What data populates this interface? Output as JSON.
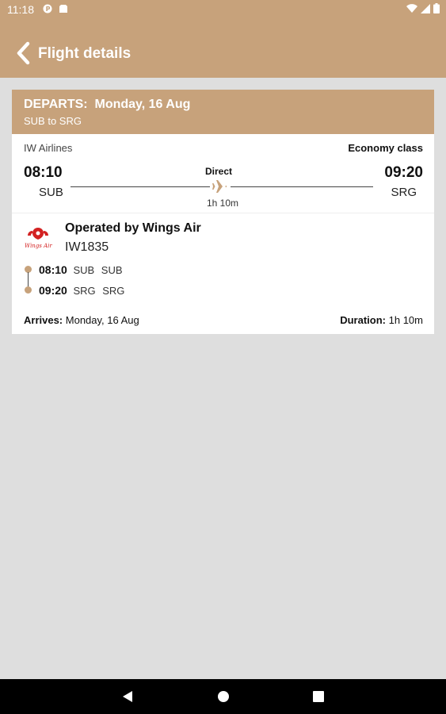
{
  "status": {
    "time": "11:18"
  },
  "appbar": {
    "title": "Flight details"
  },
  "flight": {
    "departs_label": "DEPARTS:",
    "departs_date": "Monday, 16 Aug",
    "route": "SUB to SRG",
    "airline": "IW Airlines",
    "cabin": "Economy class",
    "dep_time": "08:10",
    "dep_code": "SUB",
    "arr_time": "09:20",
    "arr_code": "SRG",
    "stops": "Direct",
    "duration": "1h 10m",
    "operated_by": "Operated by Wings Air",
    "flight_number": "IW1835",
    "segments": [
      {
        "time": "08:10",
        "code": "SUB",
        "city": "SUB"
      },
      {
        "time": "09:20",
        "code": "SRG",
        "city": "SRG"
      }
    ],
    "arrives_label": "Arrives:",
    "arrives_date": "Monday, 16 Aug",
    "duration_label": "Duration:",
    "duration_value": "1h 10m",
    "logo_text": "Wings Air"
  },
  "colors": {
    "accent": "#c7a27b",
    "background": "#dedede"
  }
}
